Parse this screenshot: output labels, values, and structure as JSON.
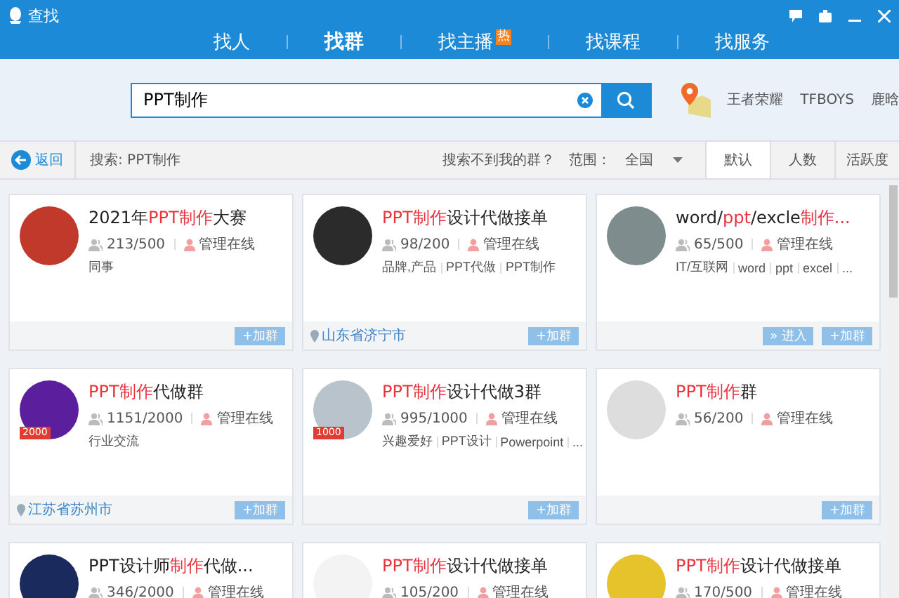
{
  "window": {
    "title": "查找"
  },
  "tabs": [
    {
      "label": "找人",
      "selected": false
    },
    {
      "label": "找群",
      "selected": true
    },
    {
      "label": "找主播",
      "selected": false,
      "badge": "热"
    },
    {
      "label": "找课程",
      "selected": false
    },
    {
      "label": "找服务",
      "selected": false
    }
  ],
  "search": {
    "value": "PPT制作"
  },
  "hot_words": [
    "王者荣耀",
    "TFBOYS",
    "鹿晗"
  ],
  "toolbar": {
    "back": "返回",
    "query": "搜索: PPT制作",
    "not_found": "搜索不到我的群？",
    "range_label": "范围：",
    "range_value": "全国"
  },
  "sort_tabs": [
    {
      "label": "默认",
      "selected": true
    },
    {
      "label": "人数",
      "selected": false
    },
    {
      "label": "活跃度",
      "selected": false
    }
  ],
  "groups": [
    {
      "title": "2021年**PPT制作**大赛",
      "members": "213/500",
      "admin": "管理在线",
      "tags": [
        "同事"
      ],
      "buttons": [
        "+加群"
      ]
    },
    {
      "title": "**PPT制作**设计代做接单",
      "members": "98/200",
      "admin": "管理在线",
      "tags": [
        "品牌,产品",
        "PPT代做",
        "PPT制作"
      ],
      "location": "山东省济宁市",
      "buttons": [
        "+加群"
      ]
    },
    {
      "title": "word/**ppt**/excle**制作...**",
      "members": "65/500",
      "admin": "管理在线",
      "tags": [
        "IT/互联网",
        "word",
        "ppt",
        "excel",
        "..."
      ],
      "buttons": [
        "» 进入",
        "+加群"
      ]
    },
    {
      "title": "**PPT制作**代做群",
      "members": "1151/2000",
      "admin": "管理在线",
      "tags": [
        "行业交流"
      ],
      "badge": "2000",
      "location": "江苏省苏州市",
      "buttons": [
        "+加群"
      ]
    },
    {
      "title": "**PPT制作**设计代做3群",
      "members": "995/1000",
      "admin": "管理在线",
      "tags": [
        "兴趣爱好",
        "PPT设计",
        "Powerpoint",
        "..."
      ],
      "badge": "1000",
      "buttons": [
        "+加群"
      ]
    },
    {
      "title": "**PPT制作**群",
      "members": "56/200",
      "admin": "管理在线",
      "buttons": [
        "+加群"
      ]
    },
    {
      "title": "PPT设计师**制作**代做...",
      "members": "346/2000",
      "admin": "管理在线"
    },
    {
      "title": "**PPT制作**设计代做接单",
      "members": "105/200",
      "admin": "管理在线"
    },
    {
      "title": "**PPT制作**设计代做接单",
      "members": "170/500",
      "admin": "管理在线"
    }
  ]
}
